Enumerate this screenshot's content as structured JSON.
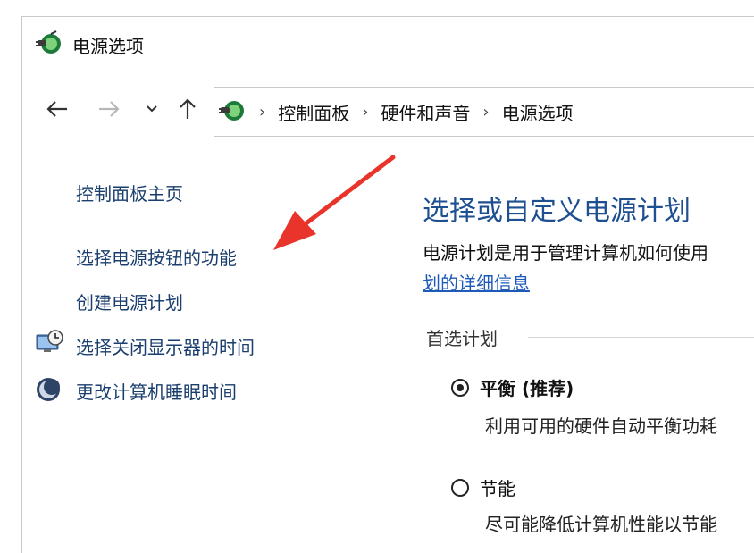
{
  "window": {
    "title": "电源选项"
  },
  "nav": {
    "back": "←",
    "forward": "→",
    "dropdown": "˅",
    "up": "↑"
  },
  "breadcrumb": [
    "控制面板",
    "硬件和声音",
    "电源选项"
  ],
  "breadcrumb_sep": "›",
  "sidebar": {
    "home": "控制面板主页",
    "items": [
      {
        "label": "选择电源按钮的功能",
        "icon": null
      },
      {
        "label": "创建电源计划",
        "icon": null
      },
      {
        "label": "选择关闭显示器的时间",
        "icon": "monitor-clock-icon"
      },
      {
        "label": "更改计算机睡眠时间",
        "icon": "moon-icon"
      }
    ]
  },
  "main": {
    "title": "选择或自定义电源计划",
    "desc_line1": "电源计划是用于管理计算机如何使用",
    "desc_link": "划的详细信息",
    "section_label": "首选计划",
    "plans": [
      {
        "name": "平衡 (推荐)",
        "selected": true,
        "desc": "利用可用的硬件自动平衡功耗"
      },
      {
        "name": "节能",
        "selected": false,
        "desc": "尽可能降低计算机性能以节能"
      }
    ]
  },
  "annotation": {
    "color": "#e8342a"
  }
}
